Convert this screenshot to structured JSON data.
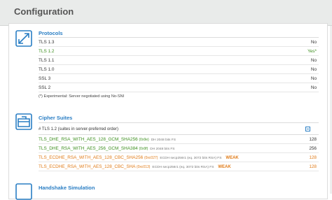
{
  "page": {
    "title": "Configuration"
  },
  "protocols": {
    "title": "Protocols",
    "rows": [
      {
        "label": "TLS 1.3",
        "value": "No"
      },
      {
        "label": "TLS 1.2",
        "value": "Yes*"
      },
      {
        "label": "TLS 1.1",
        "value": "No"
      },
      {
        "label": "TLS 1.0",
        "value": "No"
      },
      {
        "label": "SSL 3",
        "value": "No"
      },
      {
        "label": "SSL 2",
        "value": "No"
      }
    ],
    "note": "(*) Experimental: Server negotiated using No-SNI"
  },
  "cipher_suites": {
    "title": "Cipher Suites",
    "subheader": "# TLS 1.2 (suites in server-preferred order)",
    "rows": [
      {
        "name": "TLS_DHE_RSA_WITH_AES_128_GCM_SHA256",
        "code": "(0x9e)",
        "meta": "DH 2048 bits   FS",
        "weak": "",
        "value": "128"
      },
      {
        "name": "TLS_DHE_RSA_WITH_AES_256_GCM_SHA384",
        "code": "(0x9f)",
        "meta": "DH 2048 bits   FS",
        "weak": "",
        "value": "256"
      },
      {
        "name": "TLS_ECDHE_RSA_WITH_AES_128_CBC_SHA256",
        "code": "(0xc027)",
        "meta": "ECDH secp256r1 (eq. 3072 bits RSA)   FS",
        "weak": "WEAK",
        "value": "128"
      },
      {
        "name": "TLS_ECDHE_RSA_WITH_AES_128_CBC_SHA",
        "code": "(0xc013)",
        "meta": "ECDH secp256r1 (eq. 3072 bits RSA)   FS",
        "weak": "WEAK",
        "value": "128"
      }
    ]
  },
  "handshake": {
    "title": "Handshake Simulation"
  },
  "colors": {
    "accent": "#2a7ec4",
    "green": "#3d8f1f",
    "orange": "#e07b17"
  }
}
